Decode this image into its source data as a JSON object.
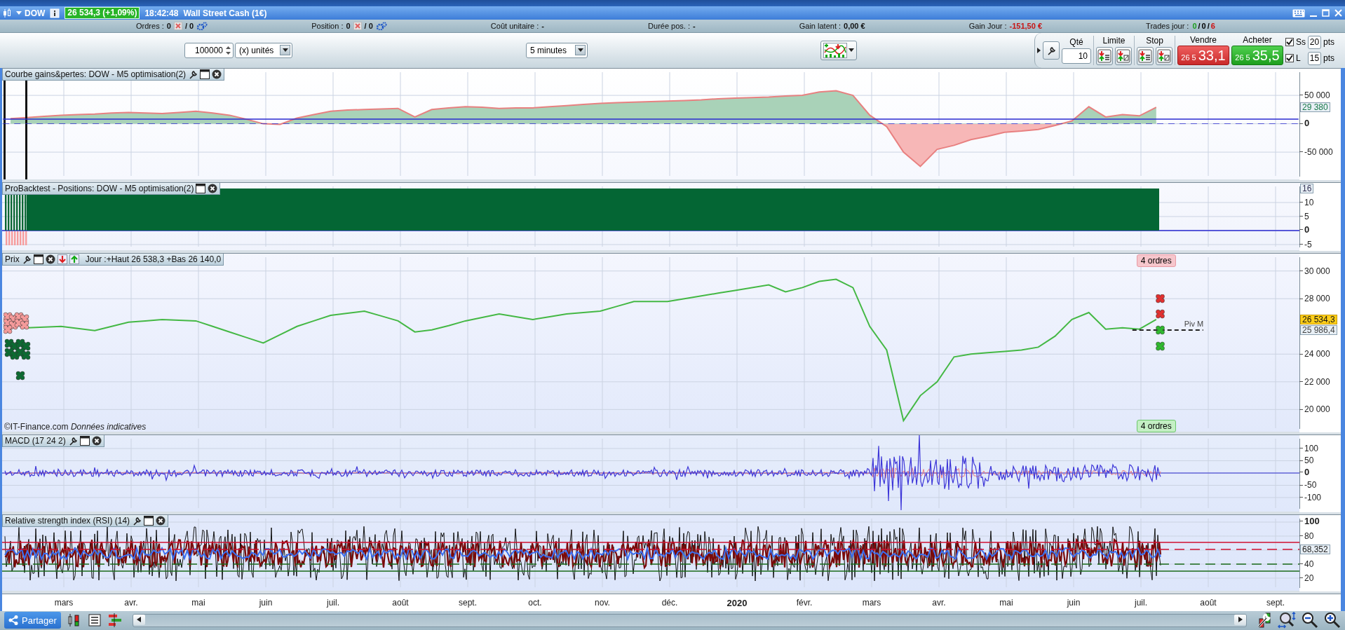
{
  "title_bar": {
    "symbol": "DOW",
    "price_badge": "26 534,3 (+1,09%)",
    "time": "18:42:48",
    "instrument": "Wall Street Cash (1€)"
  },
  "stats": [
    {
      "kind": "counter",
      "label": "Ordres :",
      "value": "0",
      "pending": "/ 0"
    },
    {
      "kind": "counter",
      "label": "Position :",
      "value": "0",
      "pending": "/ 0"
    },
    {
      "kind": "plain",
      "label": "Coût unitaire :",
      "value": "-"
    },
    {
      "kind": "plain",
      "label": "Durée pos. :",
      "value": "-"
    },
    {
      "kind": "money",
      "label": "Gain latent :",
      "value": "0,00 €",
      "negative": false
    },
    {
      "kind": "money",
      "label": "Gain Jour :",
      "value": "-151,50 €",
      "negative": true
    },
    {
      "kind": "trades",
      "label": "Trades jour :",
      "parts": [
        {
          "text": "0",
          "color": "#1e9e1e"
        },
        {
          "text": "/",
          "color": "#000000"
        },
        {
          "text": "0",
          "color": "#000000"
        },
        {
          "text": "/",
          "color": "#000000"
        },
        {
          "text": "6",
          "color": "#d01010"
        }
      ]
    }
  ],
  "toolbar": {
    "quantity": "100000",
    "unit": "(x) unités",
    "timeframe": "5 minutes"
  },
  "order_panel": {
    "qty_label": "Qté",
    "qty": "10",
    "limit_label": "Limite",
    "stop_label": "Stop",
    "sell": {
      "label": "Vendre",
      "prefix": "26 5",
      "price": "33,1"
    },
    "buy": {
      "label": "Acheter",
      "prefix": "26 5",
      "price": "35,5"
    },
    "stops": [
      {
        "label": "Ss",
        "checked": true,
        "value": "20",
        "unit": "pts"
      },
      {
        "label": "L",
        "checked": true,
        "value": "15",
        "unit": "pts"
      }
    ]
  },
  "panels": [
    {
      "kind": "equity",
      "title": "Courbe gains&pertes: DOW - M5 optimisation(2)",
      "chart_data": {
        "type": "area",
        "ylim": [
          -98000,
          97000
        ],
        "grid": true,
        "yticks": [
          {
            "value": 50000,
            "label": "50 000"
          },
          {
            "value": 0,
            "label": "0"
          },
          {
            "value": -50000,
            "label": "-50 000"
          }
        ],
        "categories": [
          null,
          null,
          null,
          null,
          null,
          null,
          null,
          null,
          null,
          null,
          null,
          null,
          null,
          null,
          null,
          null,
          null,
          null,
          null,
          null,
          null,
          null,
          null,
          null,
          null,
          null,
          null,
          null,
          null,
          null,
          null,
          null,
          null,
          null,
          null,
          null,
          null,
          null,
          null,
          null,
          null,
          null,
          null,
          null,
          null,
          null,
          null,
          null,
          null,
          null,
          null,
          null,
          null,
          null,
          null,
          null,
          null,
          null,
          null,
          null,
          null,
          null,
          null,
          null,
          null,
          null,
          null,
          null,
          null,
          null,
          null,
          null,
          null,
          null,
          null,
          null,
          null
        ],
        "series": [
          {
            "color": "#e88080",
            "values": [
              9000,
              11000,
              13000,
              15000,
              16000,
              17000,
              19000,
              20000,
              19000,
              18000,
              20000,
              22000,
              19000,
              15000,
              8000,
              0,
              -1000,
              10000,
              16000,
              22000,
              24000,
              25000,
              26000,
              27000,
              12000,
              25000,
              28000,
              30000,
              29000,
              27000,
              28000,
              28000,
              30000,
              32000,
              34000,
              36000,
              37000,
              38000,
              39000,
              40000,
              41000,
              42000,
              44000,
              45000,
              46000,
              47000,
              49000,
              50000,
              56000,
              58000,
              50000,
              15000,
              -5000,
              -50000,
              -75000,
              -45000,
              -38000,
              -28000,
              -22000,
              -15000,
              -13000,
              -10000,
              -3000,
              5000,
              30000,
              12000,
              16000,
              14000,
              29000,
              null,
              null,
              null,
              null,
              null,
              null,
              null,
              null
            ]
          }
        ]
      },
      "tags": [
        {
          "text": "29 380",
          "kind": "last"
        }
      ]
    },
    {
      "kind": "positions",
      "title": "ProBacktest - Positions: DOW - M5 optimisation(2)",
      "axis_labels": [
        {
          "text": "10",
          "kind": "tick"
        },
        {
          "text": "5",
          "kind": "tick"
        },
        {
          "text": "0",
          "kind": "major"
        },
        {
          "text": "-5",
          "kind": "tick"
        }
      ],
      "tags": [
        {
          "text": "16",
          "kind": "last"
        }
      ]
    },
    {
      "kind": "price",
      "title": "Prix",
      "info": "Jour :+Haut 26 538,3 +Bas 26 140,0",
      "chart_data": {
        "type": "line",
        "ylim": [
          18400,
          31250
        ],
        "grid": true,
        "yticks": [
          {
            "value": 30000,
            "label": "30 000"
          },
          {
            "value": 28000,
            "label": "28 000"
          },
          {
            "value": 24000,
            "label": "24 000"
          },
          {
            "value": 22000,
            "label": "22 000"
          },
          {
            "value": 20000,
            "label": "20 000"
          }
        ],
        "categories": [
          null,
          null,
          null,
          null,
          null,
          null,
          null,
          null,
          null,
          null,
          null,
          null,
          null,
          null,
          null,
          null,
          null,
          null,
          null,
          null,
          null,
          null,
          null,
          null,
          null,
          null,
          null,
          null,
          null,
          null,
          null,
          null,
          null,
          null,
          null,
          null,
          null,
          null,
          null,
          null,
          null,
          null,
          null,
          null,
          null,
          null,
          null,
          null,
          null,
          null,
          null,
          null,
          null,
          null,
          null,
          null,
          null,
          null,
          null,
          null,
          null,
          null,
          null,
          null,
          null,
          null,
          null,
          null,
          null,
          null,
          null,
          null,
          null,
          null,
          null,
          null,
          null
        ],
        "series": [
          {
            "color": "#44b844",
            "values": [
              null,
              25900,
              25950,
              26000,
              25850,
              25700,
              26000,
              26300,
              26400,
              26500,
              26450,
              26400,
              26000,
              25600,
              25200,
              24800,
              25400,
              26000,
              26400,
              26800,
              26950,
              27100,
              26750,
              26400,
              25600,
              25750,
              26050,
              26400,
              26650,
              26900,
              26700,
              26500,
              26700,
              26900,
              27000,
              27100,
              27450,
              27800,
              27800,
              27800,
              28000,
              28200,
              28400,
              28600,
              28800,
              29000,
              28500,
              28800,
              29250,
              29400,
              28800,
              26000,
              24300,
              19200,
              21000,
              22000,
              23800,
              24000,
              24100,
              24200,
              24300,
              24500,
              25300,
              26500,
              27000,
              25800,
              25900,
              25800,
              26500,
              null,
              null,
              null,
              null,
              null,
              null,
              null,
              null
            ]
          }
        ]
      },
      "tags": [
        {
          "text": "26 534,3",
          "kind": "price"
        }
      ],
      "pivot": {
        "label": "Piv M",
        "value": "25 986,4"
      },
      "sell_orders": "4 ordres",
      "buy_orders": "4 ordres",
      "footer": "©IT-Finance.com *Données indicatives*"
    },
    {
      "kind": "macd",
      "title": "MACD (17 24 2)",
      "axis_labels": [
        {
          "text": "100",
          "kind": "tick"
        },
        {
          "text": "50",
          "kind": "tick"
        },
        {
          "text": "0",
          "kind": "major"
        },
        {
          "text": "-50",
          "kind": "tick"
        },
        {
          "text": "-100",
          "kind": "tick"
        }
      ]
    },
    {
      "kind": "rsi",
      "title": "Relative strength index (RSI) (14)",
      "axis_labels": [
        {
          "text": "100",
          "kind": "major"
        },
        {
          "text": "80",
          "kind": "tick"
        },
        {
          "text": "68,352",
          "kind": "tag"
        },
        {
          "text": "40",
          "kind": "tick"
        },
        {
          "text": "20",
          "kind": "tick"
        }
      ]
    }
  ],
  "time_axis": [
    {
      "text": "mars",
      "kind": "month"
    },
    {
      "text": "avr.",
      "kind": "month"
    },
    {
      "text": "mai",
      "kind": "month"
    },
    {
      "text": "juin",
      "kind": "month"
    },
    {
      "text": "juil.",
      "kind": "month"
    },
    {
      "text": "août",
      "kind": "month"
    },
    {
      "text": "sept.",
      "kind": "month"
    },
    {
      "text": "oct.",
      "kind": "month"
    },
    {
      "text": "nov.",
      "kind": "month"
    },
    {
      "text": "déc.",
      "kind": "month"
    },
    {
      "text": "2020",
      "kind": "year"
    },
    {
      "text": "févr.",
      "kind": "month"
    },
    {
      "text": "mars",
      "kind": "month"
    },
    {
      "text": "avr.",
      "kind": "month"
    },
    {
      "text": "mai",
      "kind": "month"
    },
    {
      "text": "juin",
      "kind": "month"
    },
    {
      "text": "juil.",
      "kind": "month"
    },
    {
      "text": "août",
      "kind": "month"
    },
    {
      "text": "sept.",
      "kind": "month"
    }
  ],
  "bottom_bar": {
    "share_button": "Partager"
  }
}
